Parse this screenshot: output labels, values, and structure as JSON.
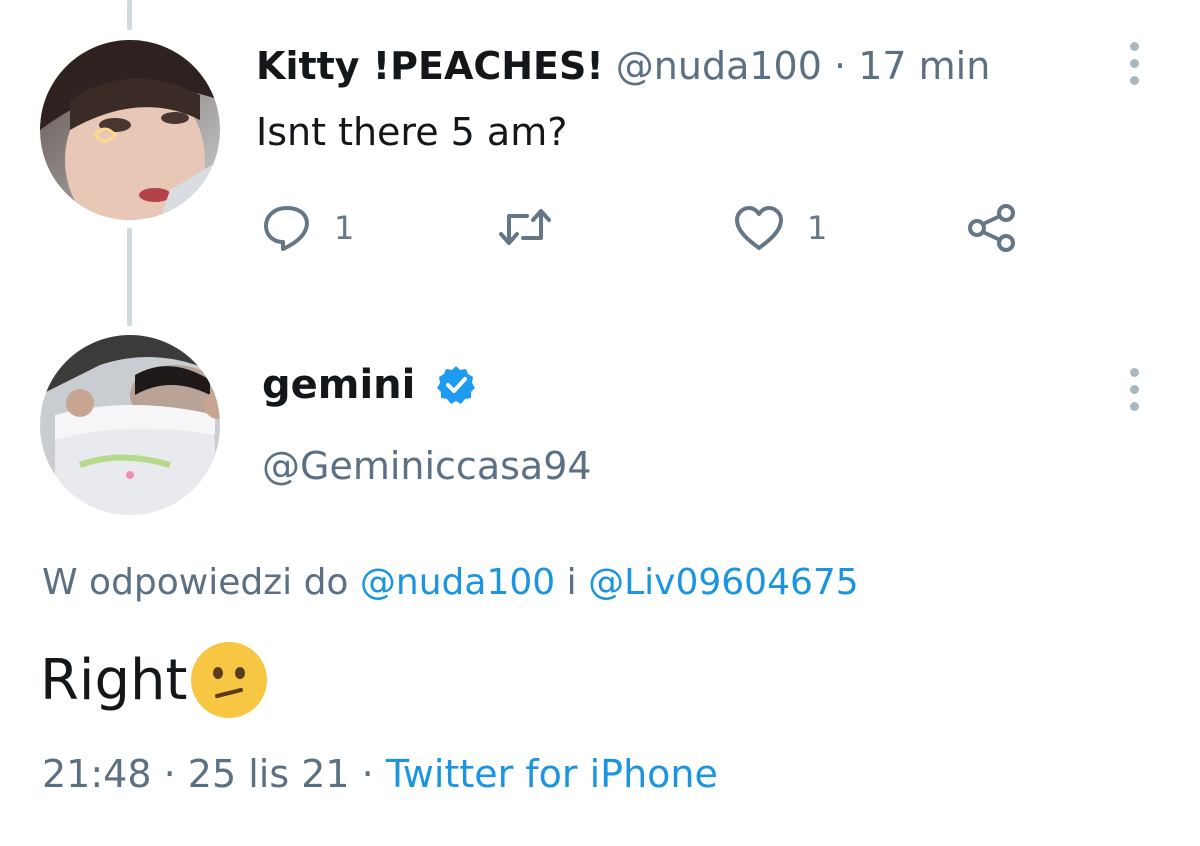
{
  "tweet1": {
    "display_name": "Kitty !PEACHES!",
    "handle": "@nuda100",
    "separator": "·",
    "time": "17 min",
    "text": "Isnt there 5 am?",
    "reply_count": "1",
    "like_count": "1"
  },
  "tweet2": {
    "display_name": "gemini",
    "handle": "@Geminiccasa94",
    "reply_prefix": "W odpowiedzi do",
    "reply_user1": "@nuda100",
    "reply_conjunction": "i",
    "reply_user2": "@Liv09604675",
    "text": "Right",
    "time": "21:48",
    "separator": "·",
    "date": "25 lis 21",
    "source": "Twitter for iPhone"
  },
  "icons": {
    "reply": "reply-icon",
    "retweet": "retweet-icon",
    "like": "heart-icon",
    "share": "share-icon",
    "more": "more-vertical-icon",
    "verified": "verified-badge-icon",
    "emoji": "confused-face-emoji"
  },
  "colors": {
    "link": "#1b95e0",
    "muted": "#5b7083",
    "verified": "#1d9bf0",
    "thread_line": "#cfd9de"
  }
}
